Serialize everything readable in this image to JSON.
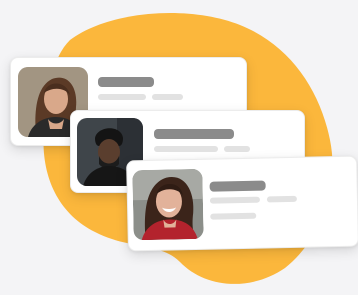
{
  "colors": {
    "background": "#f4f4f6",
    "blob": "#fbb73c",
    "card": "#ffffff",
    "title_placeholder": "#8b8b8b",
    "line_placeholder": "#e2e2e2"
  },
  "cards": [
    {
      "avatar": "woman-long-hair-photo"
    },
    {
      "avatar": "man-dark-jacket-photo"
    },
    {
      "avatar": "smiling-woman-red-top-photo"
    }
  ]
}
